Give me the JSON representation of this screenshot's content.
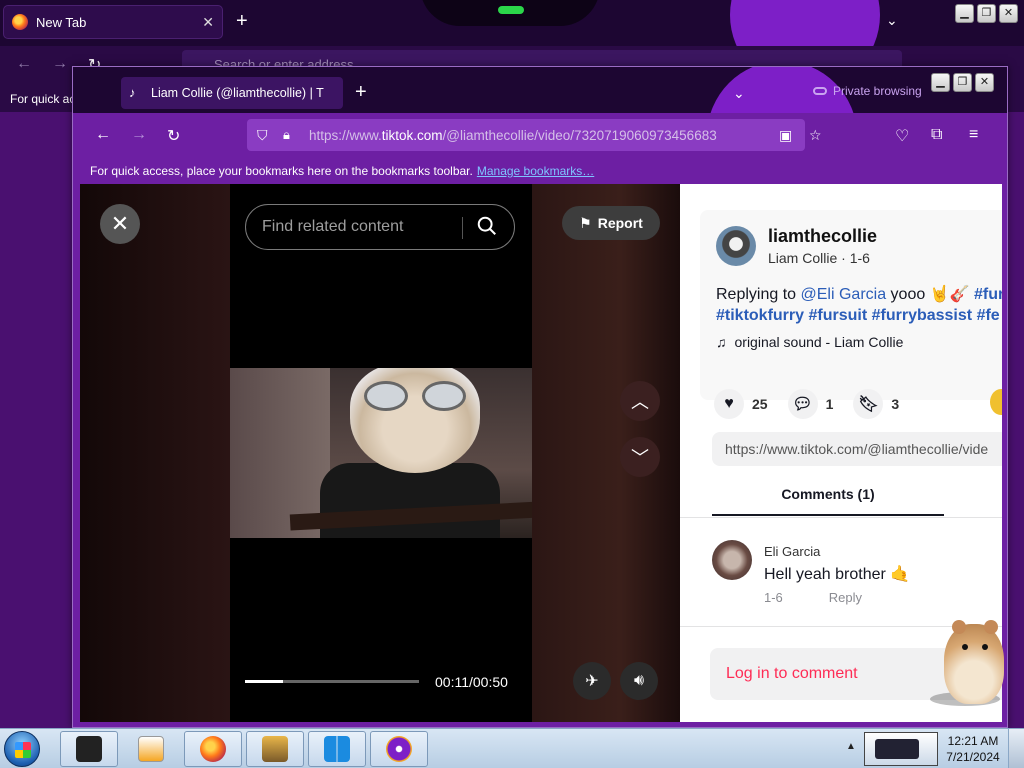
{
  "background_window": {
    "tab_title": "New Tab",
    "address_placeholder": "Search or enter address",
    "bookmark_text": "For quick ac"
  },
  "browser": {
    "tab_title": "Liam Collie (@liamthecollie) | T",
    "private_label": "Private browsing",
    "url_prefix": "https://www.",
    "url_domain": "tiktok.com",
    "url_path": "/@liamthecollie/video/7320719060973456683",
    "bookmarks_text": "For quick access, place your bookmarks here on the bookmarks toolbar.",
    "manage_bookmarks": "Manage bookmarks…"
  },
  "video": {
    "search_placeholder": "Find related content",
    "report_label": "Report",
    "time": "00:11/00:50",
    "progress": 0.22
  },
  "post": {
    "username": "liamthecollie",
    "subtitle": "Liam Collie · 1-6",
    "reply_prefix": "Replying to ",
    "mention": "@Eli Garcia",
    "caption": " yooo 🤘🎸 ",
    "tag1": "#fur",
    "tag2": "#tiktokfurry",
    "tag3": "#fursuit",
    "tag4": "#furrybassist",
    "tag5": "#fe",
    "sound": "original sound - Liam Collie",
    "likes": "25",
    "comments": "1",
    "saves": "3",
    "share_link": "https://www.tiktok.com/@liamthecollie/vide",
    "comments_tab": "Comments (1)"
  },
  "comment": {
    "author": "Eli Garcia",
    "text": "Hell yeah brother 🤙",
    "date": "1-6",
    "reply_label": "Reply"
  },
  "login_prompt": "Log in to comment",
  "taskbar": {
    "time": "12:21 AM",
    "date": "7/21/2024"
  },
  "colors": {
    "browser_purple": "#6d1fa3",
    "tiktok_red": "#fe2c55",
    "hashtag_blue": "#2b5db8"
  }
}
